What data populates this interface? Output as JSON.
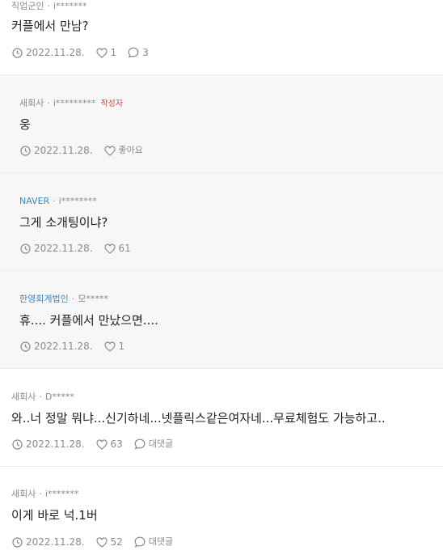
{
  "comments": [
    {
      "company": "직업군인",
      "user": "i*******",
      "text": "커플에서 만남?",
      "date": "2022.11.28.",
      "likes": "1",
      "replies": "3"
    },
    {
      "company": "새회사",
      "user": "i*********",
      "op_tag": "작성자",
      "text": "웅",
      "date": "2022.11.28.",
      "likes": "좋아요"
    },
    {
      "company": "NAVER",
      "user": "i********",
      "text": "그게 소개팅이냐?",
      "date": "2022.11.28.",
      "likes": "61"
    },
    {
      "company": "한영회계법인",
      "user": "모*****",
      "text": "휴.... 커플에서 만났으면....",
      "date": "2022.11.28.",
      "likes": "1"
    },
    {
      "company": "새회사",
      "user": "D*****",
      "text": "와..너 정말 뭐냐...신기하네...넷플릭스같은여자네...무료체험도 가능하고..",
      "date": "2022.11.28.",
      "likes": "63",
      "replies": "대댓글"
    },
    {
      "company": "새회사",
      "user": "i*******",
      "text": "이게 바로 넉.1버",
      "date": "2022.11.28.",
      "likes": "52",
      "replies": "대댓글"
    }
  ]
}
